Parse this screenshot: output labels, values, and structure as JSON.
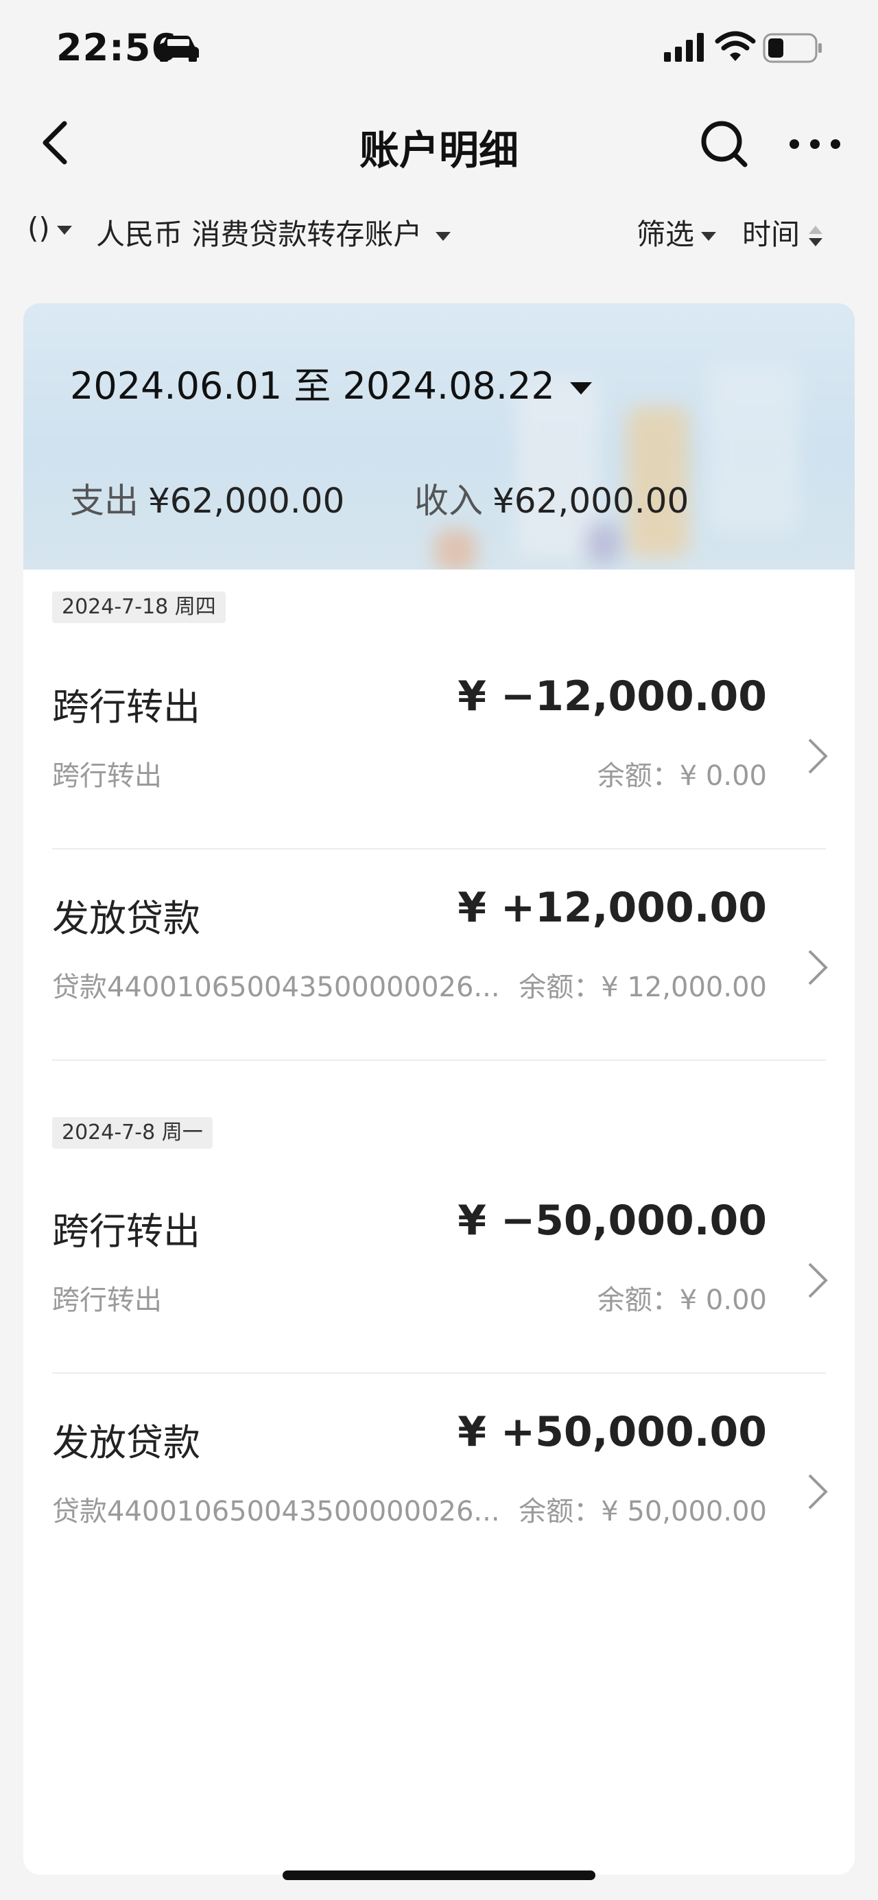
{
  "status_bar": {
    "time": "22:56"
  },
  "nav": {
    "title": "账户明细"
  },
  "filter": {
    "account_prefix": "()",
    "account_label": "人民币 消费贷款转存账户",
    "filter_label": "筛选",
    "sort_label": "时间"
  },
  "summary": {
    "date_range": "2024.06.01 至 2024.08.22",
    "expense_label": "支出",
    "expense_value": "¥62,000.00",
    "income_label": "收入",
    "income_value": "¥62,000.00"
  },
  "groups": [
    {
      "date": "2024-7-18 周四",
      "transactions": [
        {
          "title": "跨行转出",
          "amount": "¥ −12,000.00",
          "subtitle": "跨行转出",
          "balance": "余额：¥ 0.00"
        },
        {
          "title": "发放贷款",
          "amount": "¥ +12,000.00",
          "subtitle": "贷款440010650043500000026...",
          "balance": "余额：¥ 12,000.00"
        }
      ]
    },
    {
      "date": "2024-7-8 周一",
      "transactions": [
        {
          "title": "跨行转出",
          "amount": "¥ −50,000.00",
          "subtitle": "跨行转出",
          "balance": "余额：¥ 0.00"
        },
        {
          "title": "发放贷款",
          "amount": "¥ +50,000.00",
          "subtitle": "贷款440010650043500000026...",
          "balance": "余额：¥ 50,000.00"
        }
      ]
    }
  ]
}
